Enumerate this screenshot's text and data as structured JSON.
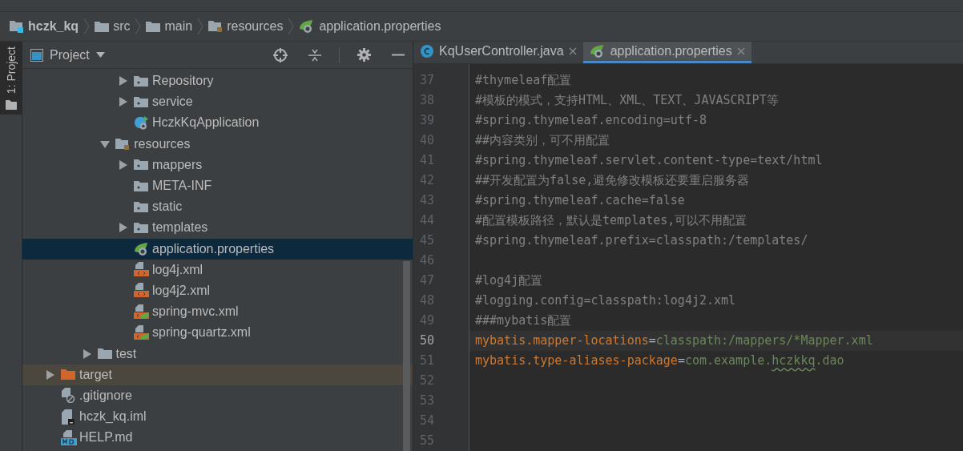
{
  "breadcrumbs": [
    {
      "label": "hczk_kq",
      "kind": "module"
    },
    {
      "label": "src",
      "kind": "folder"
    },
    {
      "label": "main",
      "kind": "folder"
    },
    {
      "label": "resources",
      "kind": "resources"
    },
    {
      "label": "application.properties",
      "kind": "spring-properties"
    }
  ],
  "side_tab": {
    "label": "1: Project",
    "selected": true
  },
  "project_panel": {
    "title": "Project"
  },
  "tree": {
    "items": [
      {
        "children": [
          {
            "children": [
              {
                "children": [
                  {
                    "children": [
                      {
                        "label": "Repository",
                        "kind": "package",
                        "expanded": false,
                        "selected": false,
                        "highlighted": false
                      },
                      {
                        "label": "service",
                        "kind": "package",
                        "expanded": false,
                        "selected": false,
                        "highlighted": false
                      },
                      {
                        "label": "HczkKqApplication",
                        "kind": "spring-class",
                        "selected": false,
                        "highlighted": false
                      }
                    ]
                  },
                  {
                    "label": "resources",
                    "kind": "resources",
                    "expanded": true,
                    "selected": false,
                    "highlighted": false,
                    "children": [
                      {
                        "label": "mappers",
                        "kind": "package",
                        "expanded": false,
                        "selected": false,
                        "highlighted": false
                      },
                      {
                        "label": "META-INF",
                        "kind": "package",
                        "selected": false,
                        "highlighted": false
                      },
                      {
                        "label": "static",
                        "kind": "package",
                        "selected": false,
                        "highlighted": false
                      },
                      {
                        "label": "templates",
                        "kind": "package",
                        "expanded": false,
                        "selected": false,
                        "highlighted": false
                      },
                      {
                        "label": "application.properties",
                        "kind": "spring-properties",
                        "selected": true,
                        "highlighted": false
                      },
                      {
                        "label": "log4j.xml",
                        "kind": "xml",
                        "selected": false,
                        "highlighted": false
                      },
                      {
                        "label": "log4j2.xml",
                        "kind": "xml",
                        "selected": false,
                        "highlighted": false
                      },
                      {
                        "label": "spring-mvc.xml",
                        "kind": "spring-xml",
                        "selected": false,
                        "highlighted": false
                      },
                      {
                        "label": "spring-quartz.xml",
                        "kind": "spring-xml",
                        "selected": false,
                        "highlighted": false
                      }
                    ]
                  }
                ]
              },
              {
                "label": "test",
                "kind": "folder",
                "expanded": false,
                "selected": false,
                "highlighted": false
              }
            ]
          }
        ]
      },
      {
        "label": "target",
        "kind": "excluded-folder",
        "expanded": false,
        "selected": false,
        "highlighted": true
      },
      {
        "label": ".gitignore",
        "kind": "ignore-file",
        "selected": false,
        "highlighted": false
      },
      {
        "label": "hczk_kq.iml",
        "kind": "iml-file",
        "selected": false,
        "highlighted": false
      },
      {
        "label": "HELP.md",
        "kind": "md-file",
        "selected": false,
        "highlighted": false
      }
    ]
  },
  "editor_tabs": [
    {
      "label": "KqUserController.java",
      "kind": "java-class",
      "selected": false
    },
    {
      "label": "application.properties",
      "kind": "spring-properties",
      "selected": true
    }
  ],
  "editor": {
    "lines": [
      {
        "number": "37",
        "current": false,
        "segments": [
          {
            "kind": "comment",
            "text": "#thymeleaf配置"
          }
        ]
      },
      {
        "number": "38",
        "current": false,
        "segments": [
          {
            "kind": "comment",
            "text": "#模板的模式，支持HTML、XML、TEXT、JAVASCRIPT等"
          }
        ]
      },
      {
        "number": "39",
        "current": false,
        "segments": [
          {
            "kind": "comment",
            "text": "#spring.thymeleaf.encoding=utf-8"
          }
        ]
      },
      {
        "number": "40",
        "current": false,
        "segments": [
          {
            "kind": "comment",
            "text": "##内容类别，可不用配置"
          }
        ]
      },
      {
        "number": "41",
        "current": false,
        "segments": [
          {
            "kind": "comment",
            "text": "#spring.thymeleaf.servlet.content-type=text/html"
          }
        ]
      },
      {
        "number": "42",
        "current": false,
        "segments": [
          {
            "kind": "comment",
            "text": "##开发配置为false,避免修改模板还要重启服务器"
          }
        ]
      },
      {
        "number": "43",
        "current": false,
        "segments": [
          {
            "kind": "comment",
            "text": "#spring.thymeleaf.cache=false"
          }
        ]
      },
      {
        "number": "44",
        "current": false,
        "segments": [
          {
            "kind": "comment",
            "text": "#配置模板路径，默认是templates,可以不用配置"
          }
        ]
      },
      {
        "number": "45",
        "current": false,
        "segments": [
          {
            "kind": "comment",
            "text": "#spring.thymeleaf.prefix=classpath:/templates/"
          }
        ]
      },
      {
        "number": "46",
        "current": false
      },
      {
        "number": "47",
        "current": false,
        "segments": [
          {
            "kind": "comment",
            "text": "#log4j配置"
          }
        ]
      },
      {
        "number": "48",
        "current": false,
        "segments": [
          {
            "kind": "comment",
            "text": "#logging.config=classpath:log4j2.xml"
          }
        ]
      },
      {
        "number": "49",
        "current": false,
        "segments": [
          {
            "kind": "comment",
            "text": "###mybatis配置"
          }
        ]
      },
      {
        "number": "50",
        "current": true,
        "segments": [
          {
            "kind": "key",
            "text": "mybatis.mapper-locations"
          },
          {
            "kind": "sep",
            "text": "="
          },
          {
            "kind": "value",
            "text": "classpath:/mappers/*Mapper.xml"
          }
        ]
      },
      {
        "number": "51",
        "current": false,
        "segments": [
          {
            "kind": "key",
            "text": "mybatis.type-aliases-package"
          },
          {
            "kind": "sep",
            "text": "="
          },
          {
            "kind": "value",
            "text": "com.example."
          },
          {
            "kind": "typo",
            "text": "hczkkq"
          },
          {
            "kind": "value",
            "text": ".dao"
          }
        ]
      },
      {
        "number": "52",
        "current": false
      },
      {
        "number": "53",
        "current": false
      },
      {
        "number": "54",
        "current": false
      },
      {
        "number": "55",
        "current": false
      }
    ]
  }
}
